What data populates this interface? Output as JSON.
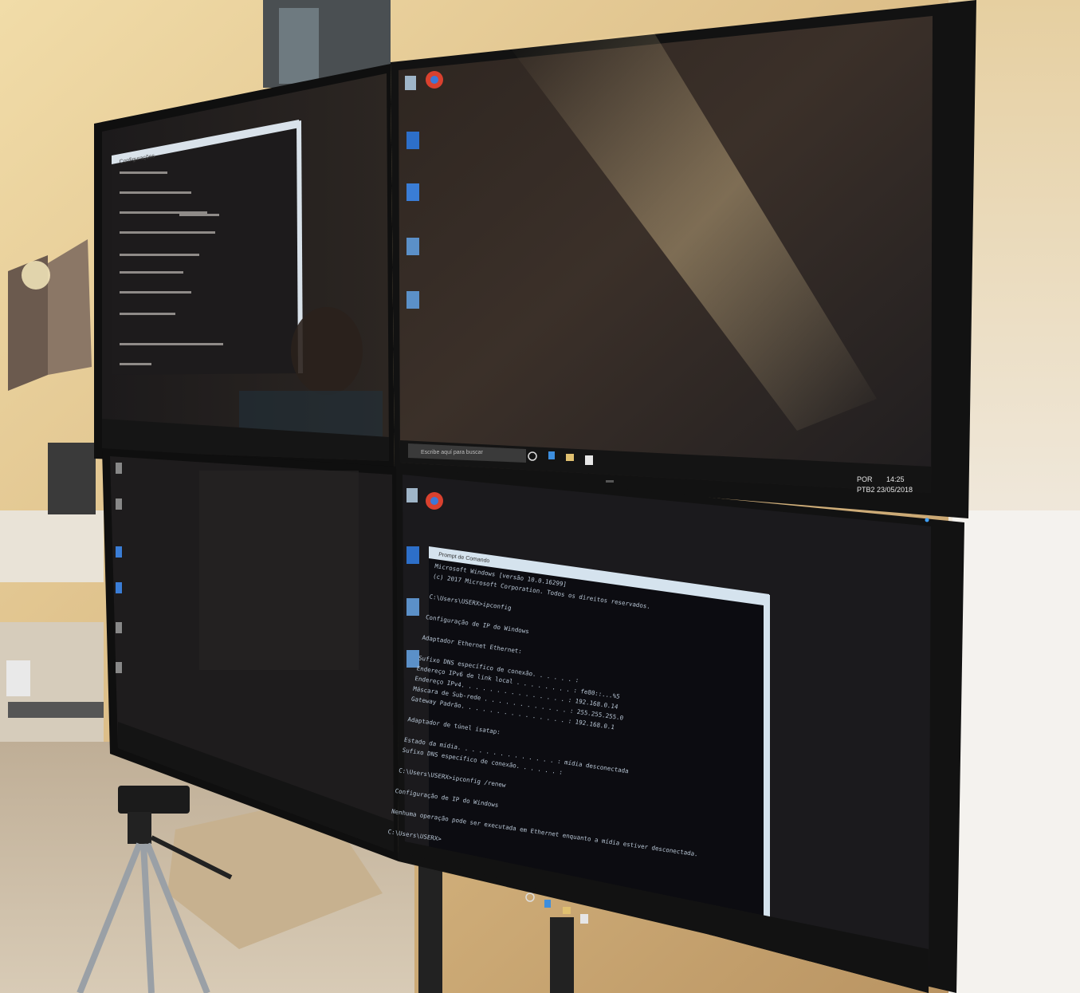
{
  "scene": {
    "description_visible_text": {
      "top_right_taskbar": {
        "search_placeholder": "Escribe aquí para buscar",
        "lang": "POR",
        "lang_sub": "PTB2",
        "time": "14:25",
        "date": "23/05/2018"
      },
      "top_right_desktop_icons": [
        "Lixeira",
        "Google Chrome",
        "",
        "",
        "",
        ""
      ],
      "bottom_right_desktop_icons": [
        "Lixeira",
        "Google Chrome",
        "",
        "",
        ""
      ],
      "bottom_right_cmd": {
        "window_title": "Prompt de Comando",
        "lines": [
          "Microsoft Windows [versão 10.0.16299]",
          "(c) 2017 Microsoft Corporation. Todos os direitos reservados.",
          "",
          "C:\\Users\\USERX>ipconfig",
          "",
          "Configuração de IP do Windows",
          "",
          "Adaptador Ethernet Ethernet:",
          "",
          "   Sufixo DNS específico de conexão. . . . . . :",
          "   Endereço IPv6 de link local . . . . . . . . : fe80::...%5",
          "   Endereço IPv4. . . . . . . . . . . . . . . : 192.168.0.14",
          "   Máscara de Sub-rede . . . . . . . . . . . . : 255.255.255.0",
          "   Gateway Padrão. . . . . . . . . . . . . . . : 192.168.0.1",
          "",
          "Adaptador de túnel isatap:",
          "",
          "   Estado da mídia. . . . . . . . . . . . . . : mídia desconectada",
          "   Sufixo DNS específico de conexão. . . . . . :",
          "",
          "C:\\Users\\USERX>ipconfig /renew",
          "",
          "Configuração de IP do Windows",
          "",
          "Nenhuma operação pode ser executada em Ethernet enquanto a mídia estiver desconectada.",
          "",
          "C:\\Users\\USERX>"
        ]
      },
      "top_left_window": {
        "window_title": "Configurações",
        "lines": [
          "Windows",
          "Exibir",
          "Notificações e ações",
          "Energia e suspensão",
          "Armazenamento",
          "Modo tablet",
          "Multitarefas",
          "Projetando neste computador",
          "Experiências compartilhadas",
          "Sobre"
        ]
      }
    }
  },
  "colors": {
    "wall_warm": "#e8cf9a",
    "bezel": "#141414",
    "screen": "#232121",
    "screen_reflection": "#3a3128",
    "cmd_bg": "#0d0d12",
    "cmd_text": "#b9c7d6",
    "titlebar": "#d7e4ee",
    "floor": "#cdbfa8",
    "white_wall": "#f2efe9"
  }
}
